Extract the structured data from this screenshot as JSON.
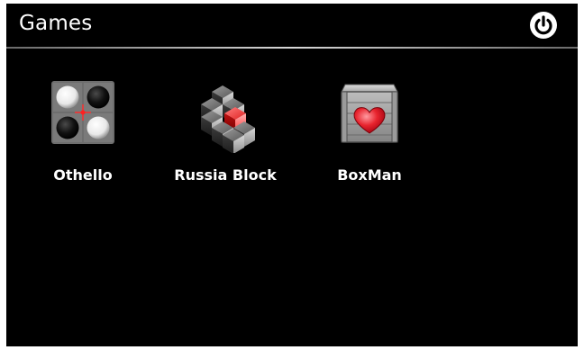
{
  "header": {
    "title": "Games",
    "power_icon": "power-icon"
  },
  "games": [
    {
      "label": "Othello",
      "icon": "othello-icon"
    },
    {
      "label": "Russia Block",
      "icon": "russia-block-icon"
    },
    {
      "label": "BoxMan",
      "icon": "boxman-icon"
    }
  ],
  "colors": {
    "background": "#000000",
    "text": "#ffffff",
    "accent_red": "#e0202a"
  }
}
